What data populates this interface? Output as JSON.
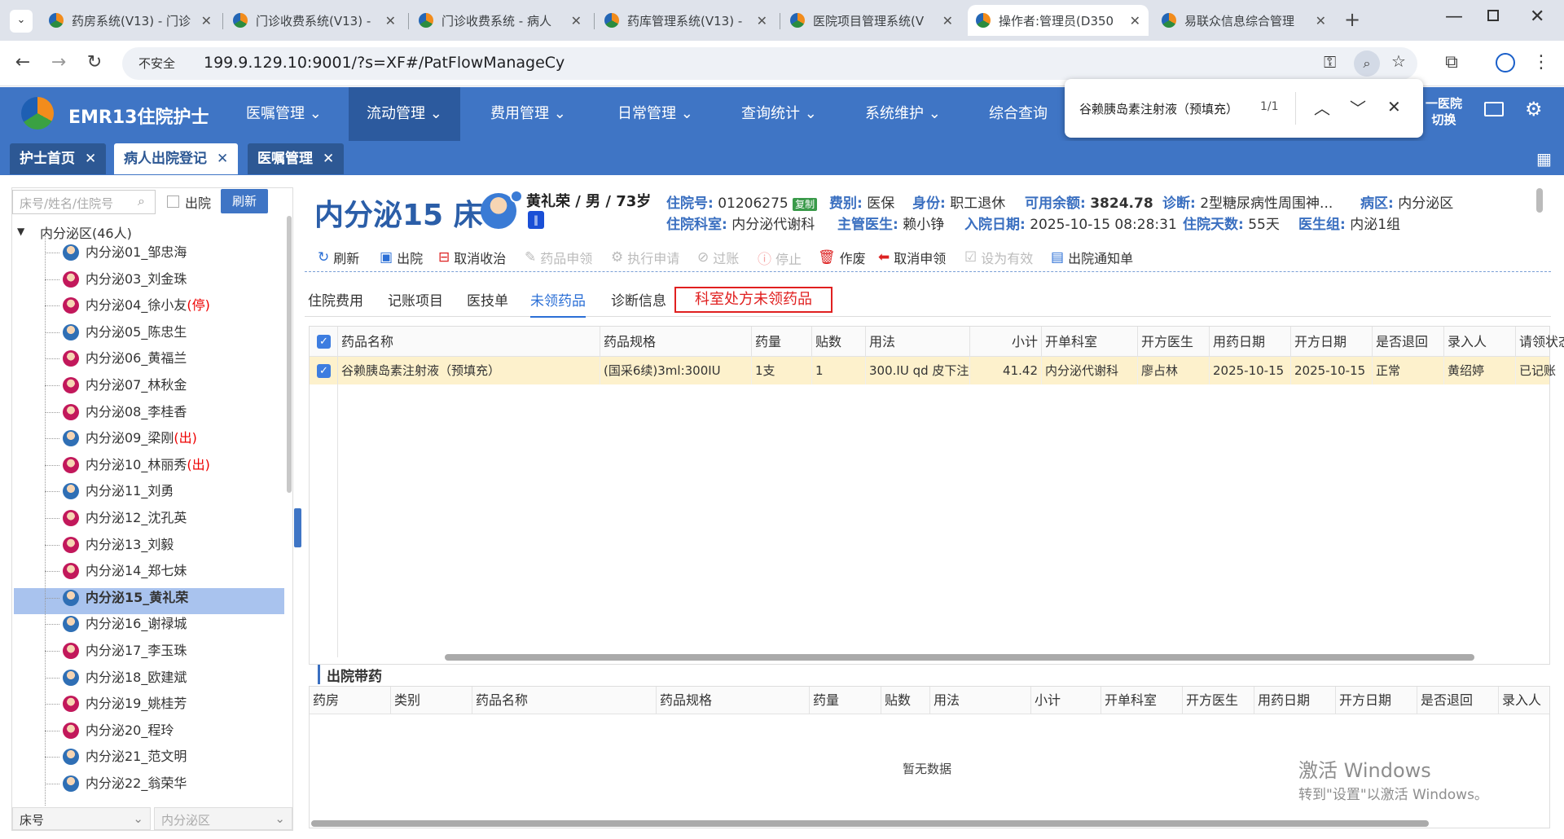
{
  "browser": {
    "tabs": [
      {
        "title": "药房系统(V13) - 门诊"
      },
      {
        "title": "门诊收费系统(V13) -"
      },
      {
        "title": "门诊收费系统 - 病人"
      },
      {
        "title": "药库管理系统(V13) -"
      },
      {
        "title": "医院项目管理系统(V"
      },
      {
        "title": "操作者:管理员(D350"
      },
      {
        "title": "易联众信息综合管理"
      }
    ],
    "insecure_label": "不安全",
    "url": "199.9.129.10:9001/?s=XF#/PatFlowManageCy"
  },
  "app": {
    "name": "EMR13住院护士",
    "menus": [
      "医嘱管理",
      "流动管理",
      "费用管理",
      "日常管理",
      "查询统计",
      "系统维护",
      "综合查询"
    ],
    "switch_label_1": "一医院",
    "switch_label_2": "切换"
  },
  "findbar": {
    "query": "谷赖胰岛素注射液（预填充）",
    "count": "1/1"
  },
  "page_tabs": [
    "护士首页",
    "病人出院登记",
    "医嘱管理"
  ],
  "left": {
    "search_placeholder": "床号/姓名/住院号",
    "discharged_label": "出院",
    "refresh_label": "刷新",
    "ward_root": "内分泌区(46人)",
    "patients": [
      {
        "label": "内分泌01_邹忠海",
        "sex": "m",
        "flag": ""
      },
      {
        "label": "内分泌03_刘金珠",
        "sex": "f",
        "flag": ""
      },
      {
        "label": "内分泌04_徐小友",
        "sex": "f",
        "flag": "(停)"
      },
      {
        "label": "内分泌05_陈忠生",
        "sex": "m",
        "flag": ""
      },
      {
        "label": "内分泌06_黄福兰",
        "sex": "f",
        "flag": ""
      },
      {
        "label": "内分泌07_林秋金",
        "sex": "f",
        "flag": ""
      },
      {
        "label": "内分泌08_李桂香",
        "sex": "f",
        "flag": ""
      },
      {
        "label": "内分泌09_梁刚",
        "sex": "m",
        "flag": "(出)"
      },
      {
        "label": "内分泌10_林丽秀",
        "sex": "f",
        "flag": "(出)"
      },
      {
        "label": "内分泌11_刘勇",
        "sex": "m",
        "flag": ""
      },
      {
        "label": "内分泌12_沈孔英",
        "sex": "f",
        "flag": ""
      },
      {
        "label": "内分泌13_刘毅",
        "sex": "f",
        "flag": ""
      },
      {
        "label": "内分泌14_郑七妹",
        "sex": "f",
        "flag": ""
      },
      {
        "label": "内分泌15_黄礼荣",
        "sex": "m",
        "flag": ""
      },
      {
        "label": "内分泌16_谢禄城",
        "sex": "m",
        "flag": ""
      },
      {
        "label": "内分泌17_李玉珠",
        "sex": "f",
        "flag": ""
      },
      {
        "label": "内分泌18_欧建斌",
        "sex": "m",
        "flag": ""
      },
      {
        "label": "内分泌19_姚桂芳",
        "sex": "f",
        "flag": ""
      },
      {
        "label": "内分泌20_程玲",
        "sex": "f",
        "flag": ""
      },
      {
        "label": "内分泌21_范文明",
        "sex": "m",
        "flag": ""
      },
      {
        "label": "内分泌22_翁荣华",
        "sex": "m",
        "flag": ""
      }
    ],
    "bottom_select_1": "床号",
    "bottom_select_2": "内分泌区"
  },
  "patient": {
    "bed": "内分泌15 床",
    "summary": "黄礼荣 / 男 / 73岁",
    "admission_no_label": "住院号:",
    "admission_no": "01206275",
    "copy_label": "复制",
    "fee_type_label": "费别:",
    "fee_type": "医保",
    "identity_label": "身份:",
    "identity": "职工退休",
    "balance_label": "可用余额:",
    "balance": "3824.78",
    "diagnosis_label": "诊断:",
    "diagnosis": "2型糖尿病性周围神...",
    "ward_label": "病区:",
    "ward": "内分泌区",
    "dept_label": "住院科室:",
    "dept": "内分泌代谢科",
    "doctor_label": "主管医生:",
    "doctor": "赖小铮",
    "admit_date_label": "入院日期:",
    "admit_date": "2025-10-15 08:28:31",
    "days_label": "住院天数:",
    "days": "55天",
    "group_label": "医生组:",
    "group": "内泌1组"
  },
  "toolbar": [
    "刷新",
    "出院",
    "取消收治",
    "药品申领",
    "执行申请",
    "过账",
    "停止",
    "作废",
    "取消申领",
    "设为有效",
    "出院通知单"
  ],
  "subtabs": [
    "住院费用",
    "记账项目",
    "医技单",
    "未领药品",
    "诊断信息"
  ],
  "highlight_tab": "科室处方未领药品",
  "grid1": {
    "columns": [
      "药品名称",
      "药品规格",
      "药量",
      "贴数",
      "用法",
      "小计",
      "开单科室",
      "开方医生",
      "用药日期",
      "开方日期",
      "是否退回",
      "录入人",
      "请领状态"
    ],
    "rows": [
      [
        "谷赖胰岛素注射液（预填充）",
        "(国采6续)3ml:300IU",
        "1支",
        "1",
        "300.IU qd 皮下注射",
        "41.42",
        "内分泌代谢科",
        "廖占林",
        "2025-10-15",
        "2025-10-15",
        "正常",
        "黄绍婷",
        "已记账"
      ]
    ]
  },
  "grid2": {
    "title": "出院带药",
    "columns": [
      "药房",
      "类别",
      "药品名称",
      "药品规格",
      "药量",
      "贴数",
      "用法",
      "小计",
      "开单科室",
      "开方医生",
      "用药日期",
      "开方日期",
      "是否退回",
      "录入人",
      "请"
    ],
    "empty_text": "暂无数据"
  },
  "watermark": {
    "line1": "激活 Windows",
    "line2": "转到\"设置\"以激活 Windows。"
  }
}
